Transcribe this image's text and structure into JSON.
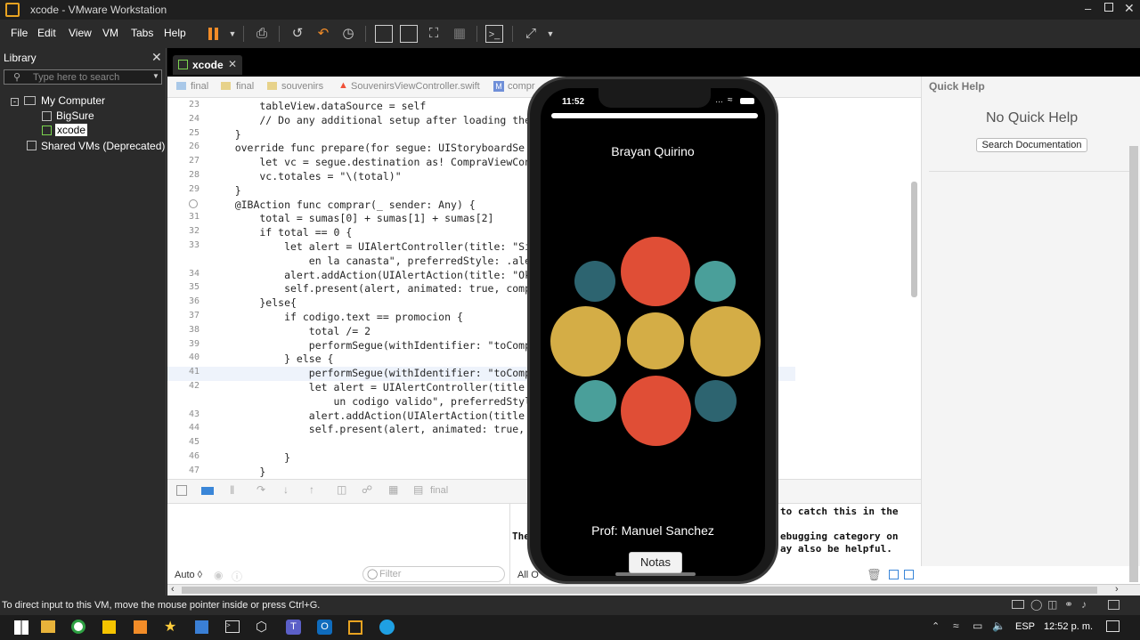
{
  "window": {
    "title": "xcode - VMware Workstation"
  },
  "menu": [
    "File",
    "Edit",
    "View",
    "VM",
    "Tabs",
    "Help"
  ],
  "library": {
    "title": "Library",
    "search_placeholder": "Type here to search",
    "tree": {
      "root": "My Computer",
      "children": [
        "BigSure",
        "xcode"
      ],
      "shared": "Shared VMs (Deprecated)"
    }
  },
  "vm_tab": {
    "label": "xcode"
  },
  "breadcrumb": [
    "final",
    "final",
    "souvenirs",
    "SouvenirsViewController.swift",
    "compr"
  ],
  "code": {
    "lines": [
      {
        "n": "23",
        "t": "        tableView.dataSource = self"
      },
      {
        "n": "24",
        "t": "        // Do any additional setup after loading the"
      },
      {
        "n": "25",
        "t": "    }"
      },
      {
        "n": "26",
        "t": "    override func prepare(for segue: UIStoryboardSe"
      },
      {
        "n": "27",
        "t": "        let vc = segue.destination as! CompraViewCon"
      },
      {
        "n": "28",
        "t": "        vc.totales = \"\\(total)\""
      },
      {
        "n": "29",
        "t": "    }"
      },
      {
        "n": "",
        "t": "    @IBAction func comprar(_ sender: Any) {"
      },
      {
        "n": "31",
        "t": "        total = sumas[0] + sumas[1] + sumas[2]"
      },
      {
        "n": "32",
        "t": "        if total == 0 {"
      },
      {
        "n": "33",
        "t": "            let alert = UIAlertController(title: \"Si"
      },
      {
        "n": "",
        "t": "                en la canasta\", preferredStyle: .ale"
      },
      {
        "n": "34",
        "t": "            alert.addAction(UIAlertAction(title: \"Ok"
      },
      {
        "n": "35",
        "t": "            self.present(alert, animated: true, comp"
      },
      {
        "n": "36",
        "t": "        }else{"
      },
      {
        "n": "37",
        "t": "            if codigo.text == promocion {"
      },
      {
        "n": "38",
        "t": "                total /= 2"
      },
      {
        "n": "39",
        "t": "                performSegue(withIdentifier: \"toComp"
      },
      {
        "n": "40",
        "t": "            } else {"
      },
      {
        "n": "41",
        "t": "                performSegue(withIdentifier: \"toComp"
      },
      {
        "n": "42",
        "t": "                let alert = UIAlertController(title"
      },
      {
        "n": "",
        "t": "                    un codigo valido\", preferredStyl"
      },
      {
        "n": "43",
        "t": "                alert.addAction(UIAlertAction(title"
      },
      {
        "n": "44",
        "t": "                self.present(alert, animated: true,"
      },
      {
        "n": "45",
        "t": ""
      },
      {
        "n": "46",
        "t": "            }"
      },
      {
        "n": "47",
        "t": "        }"
      }
    ]
  },
  "quick_help": {
    "title": "Quick Help",
    "empty": "No Quick Help",
    "button": "Search Documentation"
  },
  "debug": {
    "target": "final",
    "auto": "Auto ◊",
    "filter": "Filter",
    "all": "All O"
  },
  "console": {
    "line1": "to catch this in the",
    "line2a": "The",
    "line2b": "ebugging category on",
    "line3": "ay also be helpful."
  },
  "phone": {
    "time": "11:52",
    "name": "Brayan Quirino",
    "prof": "Prof: Manuel Sanchez",
    "button": "Notas",
    "colors": {
      "teal_dark": "#2d6470",
      "teal": "#4a9f9a",
      "red": "#e04e36",
      "gold": "#d4ad46"
    }
  },
  "status": {
    "text": "To direct input to this VM, move the mouse pointer inside or press Ctrl+G."
  },
  "taskbar": {
    "lang": "ESP",
    "time": "12:52 p. m."
  }
}
